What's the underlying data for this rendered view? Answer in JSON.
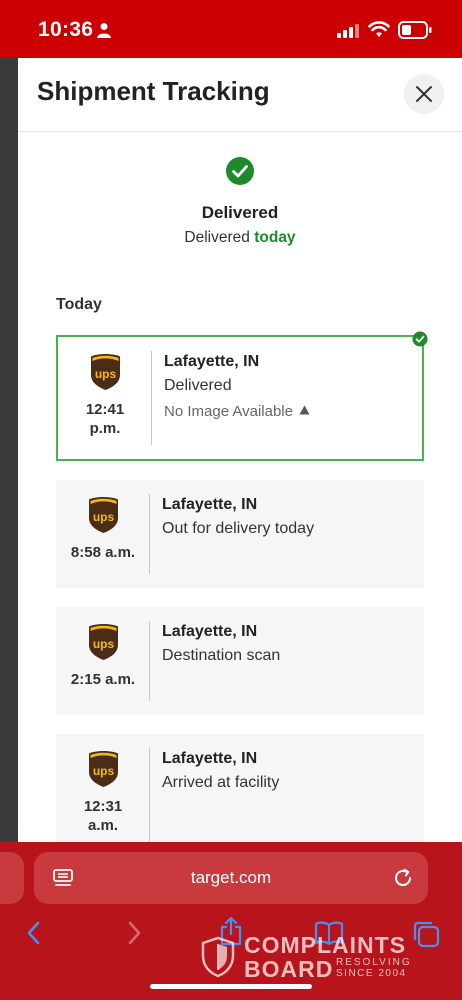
{
  "status_bar": {
    "time": "10:36",
    "icons": [
      "person-icon",
      "signal-icon",
      "wifi-icon",
      "battery-icon"
    ]
  },
  "panel": {
    "title": "Shipment Tracking",
    "close_icon": "close-icon"
  },
  "summary": {
    "icon": "check-circle-icon",
    "title": "Delivered",
    "subtitle_prefix": "Delivered",
    "subtitle_highlight": "today"
  },
  "section_label": "Today",
  "events": [
    {
      "carrier_icon": "ups-logo",
      "time_line1": "12:41",
      "time_line2": "p.m.",
      "location": "Lafayette, IN",
      "status": "Delivered",
      "note": "No Image Available",
      "active": true
    },
    {
      "carrier_icon": "ups-logo",
      "time_line1": "8:58 a.m.",
      "time_line2": "",
      "location": "Lafayette, IN",
      "status": "Out for delivery today",
      "active": false
    },
    {
      "carrier_icon": "ups-logo",
      "time_line1": "2:15 a.m.",
      "time_line2": "",
      "location": "Lafayette, IN",
      "status": "Destination scan",
      "active": false
    },
    {
      "carrier_icon": "ups-logo",
      "time_line1": "12:31",
      "time_line2": "a.m.",
      "location": "Lafayette, IN",
      "status": "Arrived at facility",
      "active": false
    }
  ],
  "browser": {
    "url": "target.com",
    "toolbar_icons": [
      "back-icon",
      "forward-icon",
      "share-icon",
      "bookmarks-icon",
      "tabs-icon"
    ]
  },
  "watermark": {
    "line1": "COMPLAINTS",
    "line2": "BOARD",
    "tag1": "RESOLVING",
    "tag2": "SINCE 2004"
  },
  "colors": {
    "brand_red": "#cc0000",
    "browser_red": "#b8141b",
    "success_green": "#1f8a2c",
    "active_border": "#4caf50",
    "ups_brown": "#4a2c17",
    "ups_gold": "#f5b915"
  }
}
